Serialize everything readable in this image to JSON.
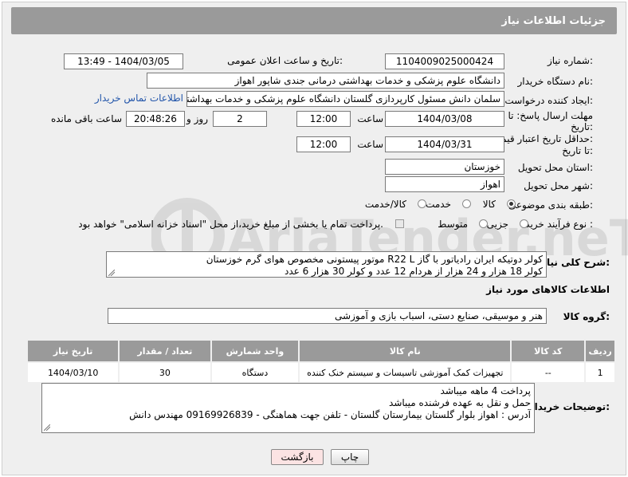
{
  "header": {
    "title": "جزئیات اطلاعات نیاز"
  },
  "fields": {
    "need_number": {
      "label": "شماره نیاز:",
      "value": "1104009025000424"
    },
    "announce": {
      "label": "تاریخ و ساعت اعلان عمومی:",
      "value": "1404/03/05 - 13:49"
    },
    "buyer": {
      "label": "نام دستگاه خریدار:",
      "value": "دانشگاه علوم پزشکی و خدمات بهداشتی درمانی جندی شاپور اهواز"
    },
    "creator": {
      "label": "ایجاد کننده درخواست:",
      "value": "سلمان دانش مسئول کارپردازی گلستان دانشگاه علوم پزشکی و خدمات بهداشتی",
      "link": "اطلاعات تماس خریدار"
    },
    "deadline": {
      "label_line1": "مهلت ارسال پاسخ: تا",
      "label_line2": "تاریخ:",
      "date": "1404/03/08",
      "time_label": "ساعت",
      "time": "12:00",
      "days": "2",
      "days_label": "روز و",
      "remaining": "20:48:26",
      "remaining_label": "ساعت باقی مانده"
    },
    "validity": {
      "label_line1": "حداقل تاریخ اعتبار قیمت:",
      "label_line2": "تا تاریخ:",
      "date": "1404/03/31",
      "time_label": "ساعت",
      "time": "12:00"
    },
    "province": {
      "label": "استان محل تحویل:",
      "value": "خوزستان"
    },
    "city": {
      "label": "شهر محل تحویل:",
      "value": "اهواز"
    },
    "category": {
      "label": "طبقه بندی موضوعی:",
      "options": [
        "کالا",
        "خدمت",
        "کالا/خدمت"
      ],
      "selected": "کالا"
    },
    "process": {
      "label": "نوع فرآیند خرید :",
      "options": [
        "جزیی",
        "متوسط"
      ],
      "note": "پرداخت تمام یا بخشی از مبلغ خرید،از محل \"اسناد خزانه اسلامی\" خواهد بود."
    }
  },
  "description": {
    "label": "شرح کلی نیاز:",
    "lines": [
      "کولر  دوتیکه ایران رادیاتور با گاز R22 L موتور پیستونی مخصوص هوای گرم خوزستان",
      "کولر 18 هزار و 24 هزار از هردام 12 عدد و کولر 30 هزار 6 عدد"
    ]
  },
  "goods_section": {
    "title": "اطلاعات کالاهای مورد نیاز",
    "group_label": "گروه کالا:",
    "group_value": "هنر و موسیقی، صنایع دستی، اسباب بازی و آموزشی",
    "columns": [
      "ردیف",
      "کد کالا",
      "نام کالا",
      "واحد شمارش",
      "تعداد / مقدار",
      "تاریخ نیاز"
    ],
    "rows": [
      [
        "1",
        "--",
        "تجهیزات کمک آموزشی تاسیسات و سیستم خنک کننده",
        "دستگاه",
        "30",
        "1404/03/10"
      ]
    ]
  },
  "buyer_notes": {
    "label": "توضیحات خریدار:",
    "lines": [
      "پرداخت 4 ماهه میباشد",
      "حمل و نقل به عهده فرشنده میباشد",
      "آدرس : اهواز بلوار گلستان بیمارستان گلستان - تلفن جهت هماهنگی - 09169926839 مهندس دانش"
    ]
  },
  "buttons": {
    "print": "چاپ",
    "back": "بازگشت"
  },
  "watermark": {
    "text": "AriaTender.neT"
  },
  "colors": {
    "header_bg": "#9a9a9a",
    "panel_bg": "#efefef",
    "link": "#2255aa",
    "back_button_bg": "#fbe3e3"
  }
}
